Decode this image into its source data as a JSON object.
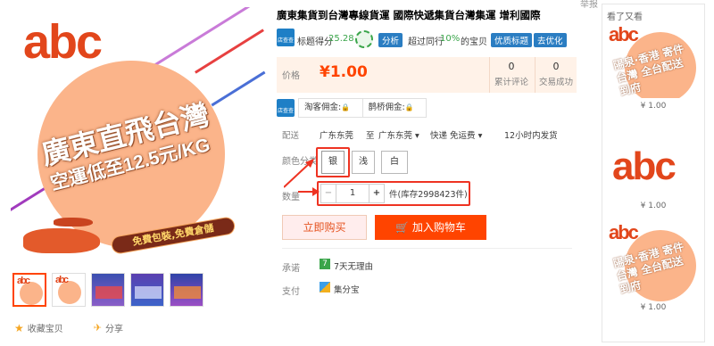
{
  "header": {
    "report_label": "举报"
  },
  "product": {
    "title": "廣東集貨到台灣專線貨運 國際快遞集貨台灣集運 增利國際"
  },
  "image": {
    "brand": "abc",
    "headline": "廣東直飛台灣",
    "subline": "空運低至12.5元/KG",
    "promo": "免費包裝,免費倉儲"
  },
  "stats": {
    "score_label": "标题得分",
    "score_value": "25.28",
    "analysis_label": "分析",
    "exceed_label": "超过同行",
    "exceed_value": "10%",
    "exceed_suffix": "的宝贝",
    "excellent_chip": "优质标题",
    "optimize_chip": "去优化",
    "icon_text": "店查查"
  },
  "price": {
    "label": "价格",
    "value": "¥1.00",
    "reviews_count": "0",
    "reviews_label": "累计评论",
    "trades_count": "0",
    "trades_label": "交易成功"
  },
  "commission": {
    "icon_text": "店查查",
    "taoke_label": "淘客佣金:",
    "queqiao_label": "鹊桥佣金:",
    "lock_glyph": "🔒"
  },
  "shipping": {
    "label": "配送",
    "from": "广东东莞",
    "to_word": "至",
    "to": "广东东莞",
    "method": "快递 免运费",
    "time": "12小时内发货"
  },
  "options": {
    "label": "颜色分类",
    "items": [
      "银",
      "浅",
      "白"
    ]
  },
  "quantity": {
    "label": "数量",
    "minus": "−",
    "value": "1",
    "plus": "+",
    "stock": "件(库存2998423件)"
  },
  "actions": {
    "buy_now": "立即购买",
    "add_cart": "加入购物车"
  },
  "guarantee": {
    "promise_label": "承诺",
    "promise_value": "7天无理由",
    "promise_icon": "7",
    "pay_label": "支付",
    "pay_value": "集分宝"
  },
  "bottom": {
    "favorite": "收藏宝贝",
    "share": "分享"
  },
  "sidebar": {
    "title": "看了又看",
    "card_text": "陽泉·香港 寄件台灣 全台配送到府",
    "card_text2": "陽泉·香港 寄件台灣 全台配送到府",
    "prices": [
      "¥ 1.00",
      "¥ 1.00",
      "¥ 1.00"
    ]
  },
  "colors": {
    "accent": "#ff4400",
    "brand_red": "#e2461b",
    "blue": "#2a7dc2",
    "green": "#3aa54a"
  }
}
